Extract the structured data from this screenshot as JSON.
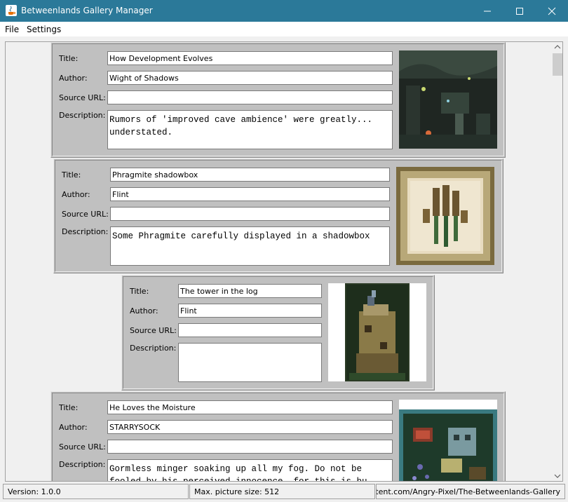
{
  "window": {
    "title": "Betweenlands Gallery Manager"
  },
  "menu": {
    "file": "File",
    "settings": "Settings"
  },
  "labels": {
    "title": "Title:",
    "author": "Author:",
    "source_url": "Source URL:",
    "description": "Description:"
  },
  "entries": [
    {
      "title": "How Development Evolves",
      "author": "Wight of Shadows",
      "source_url": "",
      "description": "Rumors of 'improved cave ambience' were greatly...\nunderstated."
    },
    {
      "title": "Phragmite shadowbox",
      "author": "Flint",
      "source_url": "",
      "description": "Some Phragmite carefully displayed in a shadowbox"
    },
    {
      "title": "The tower in the log",
      "author": "Flint",
      "source_url": "",
      "description": ""
    },
    {
      "title": "He Loves the Moisture",
      "author": "STARRYSOCK",
      "source_url": "",
      "description": "Gormless minger soaking up all my fog. Do not be\nfooled by his perceived innocence, for this is bu"
    }
  ],
  "status": {
    "version": "Version: 1.0.0",
    "max_size": "Max. picture size: 512",
    "url": "URL: https://raw.githubusercontent.com/Angry-Pixel/The-Betweenlands-Gallery"
  },
  "colors": {
    "titlebar": "#2b7999",
    "entry_bg": "#c0c0c0"
  }
}
